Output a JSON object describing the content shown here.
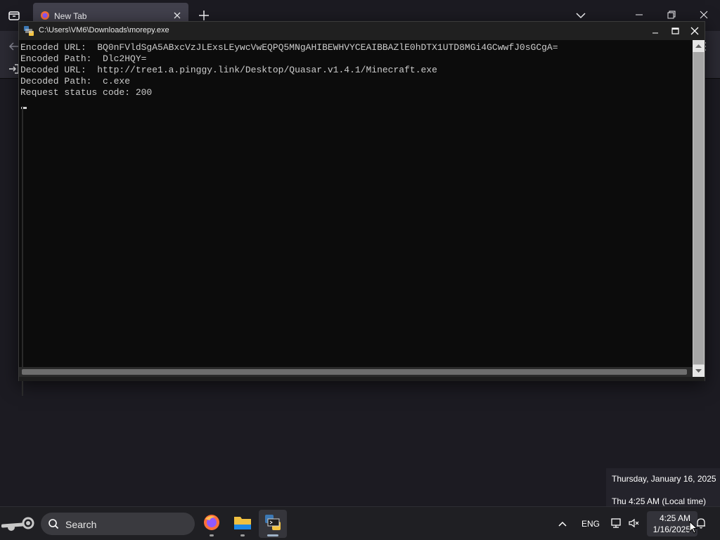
{
  "browser": {
    "tab_title": "New Tab"
  },
  "console": {
    "title": "C:\\Users\\VM6\\Downloads\\morepy.exe",
    "lines": [
      "Encoded URL:  BQ0nFVldSgA5ABxcVzJLExsLEywcVwEQPQ5MNgAHIBEWHVYCEAIBBAZlE0hDTX1UTD8MGi4GCwwfJ0sGCgA=",
      "Encoded Path:  Dlc2HQY=",
      "Decoded URL:  http://tree1.a.pinggy.link/Desktop/Quasar.v1.4.1/Minecraft.exe",
      "Decoded Path:  c.exe",
      "Request status code: 200"
    ]
  },
  "clock_flyout": {
    "date": "Thursday, January 16, 2025",
    "local_time": "Thu 4:25 AM (Local time)"
  },
  "taskbar": {
    "search_label": "Search",
    "apps": [
      "steam-icon",
      "firefox-icon",
      "file-explorer-icon",
      "python-console-icon"
    ],
    "tray": {
      "language": "ENG",
      "time": "4:25 AM",
      "date": "1/16/2025"
    }
  },
  "colors": {
    "console_bg": "#0c0c0c",
    "console_text": "#cccccc",
    "taskbar_bg": "#1f1f23",
    "browser_tab_bg": "#42414d"
  }
}
